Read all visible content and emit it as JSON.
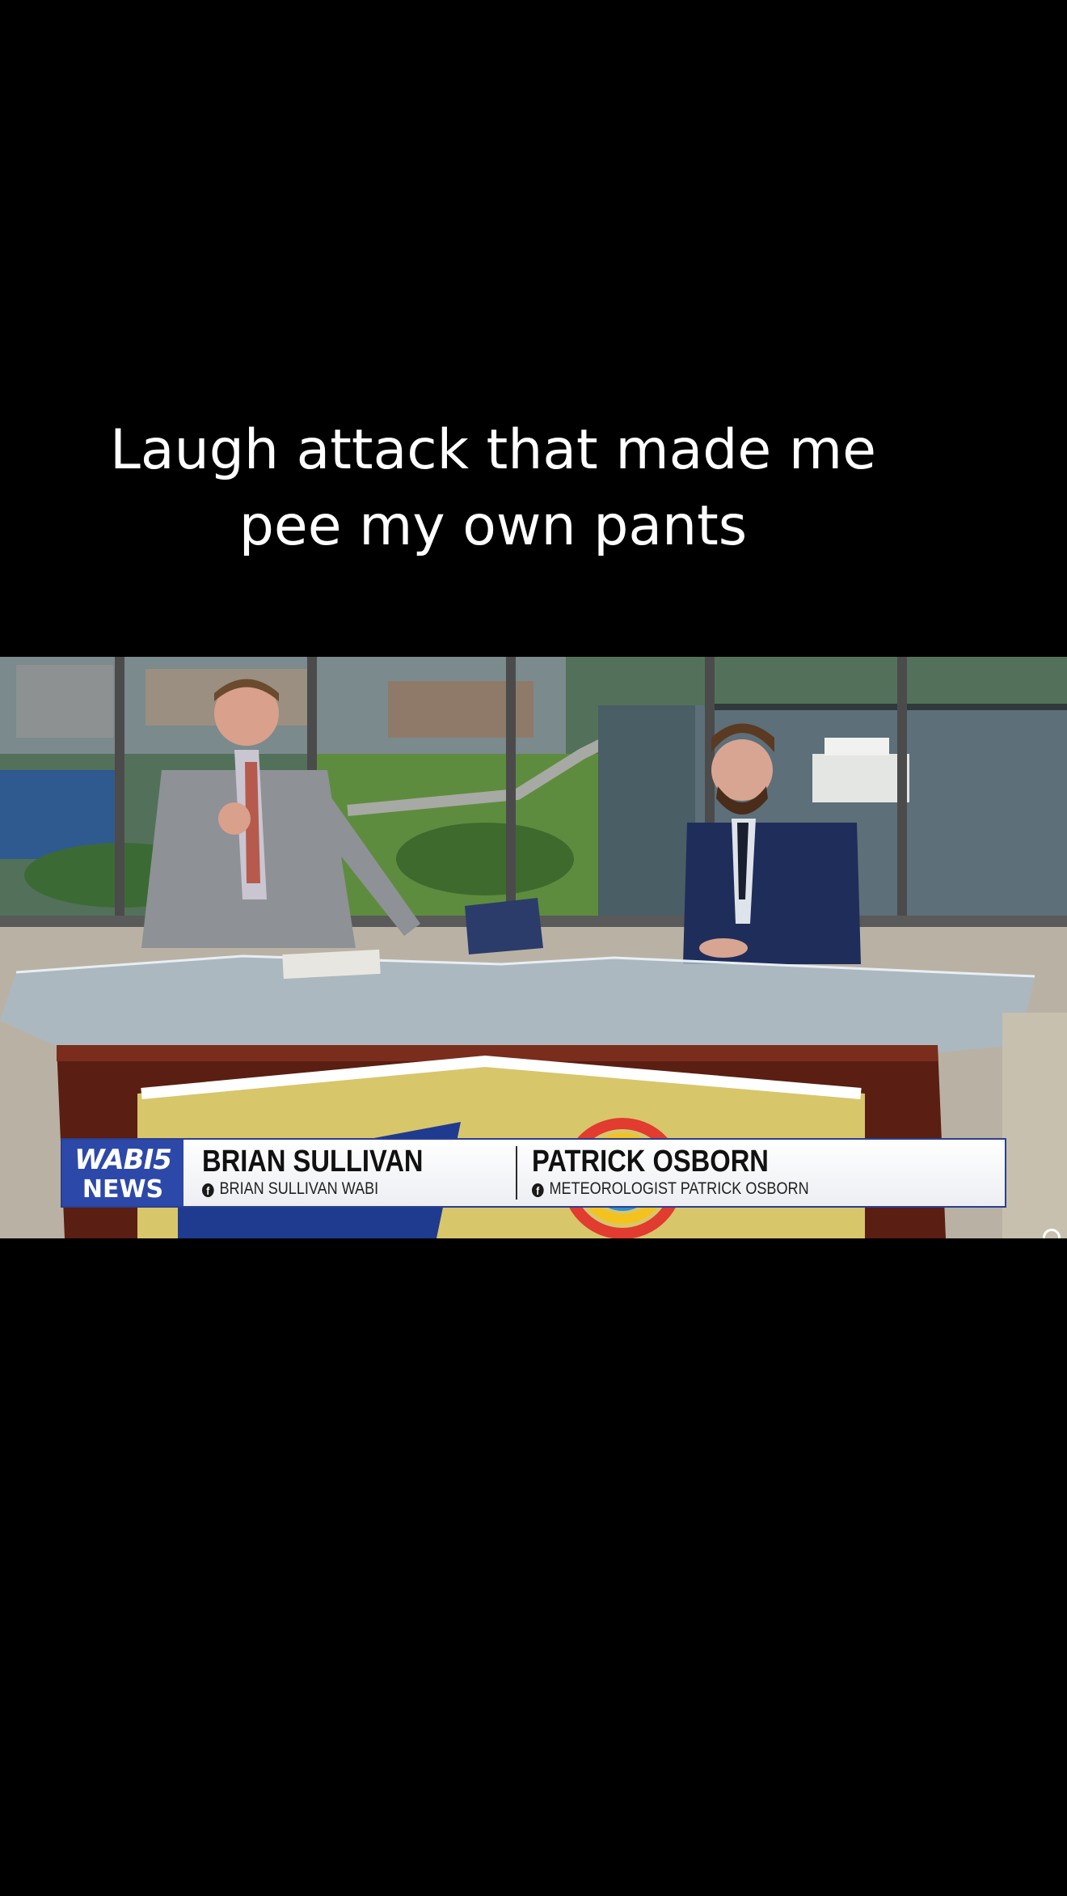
{
  "caption": {
    "line1": "Laugh attack that made me",
    "line2": "pee my own pants"
  },
  "lower_third": {
    "logo_line1": "WABI5",
    "logo_line2": "NEWS",
    "left": {
      "name": "BRIAN SULLIVAN",
      "handle": "BRIAN SULLIVAN WABI"
    },
    "right": {
      "name": "PATRICK OSBORN",
      "handle": "METEOROLOGIST PATRICK OSBORN"
    },
    "social_icon": "facebook-icon"
  },
  "colors": {
    "background": "#000000",
    "caption_text": "#ffffff",
    "brand_blue": "#2c48a8",
    "desk_wood": "#5a1e12"
  }
}
